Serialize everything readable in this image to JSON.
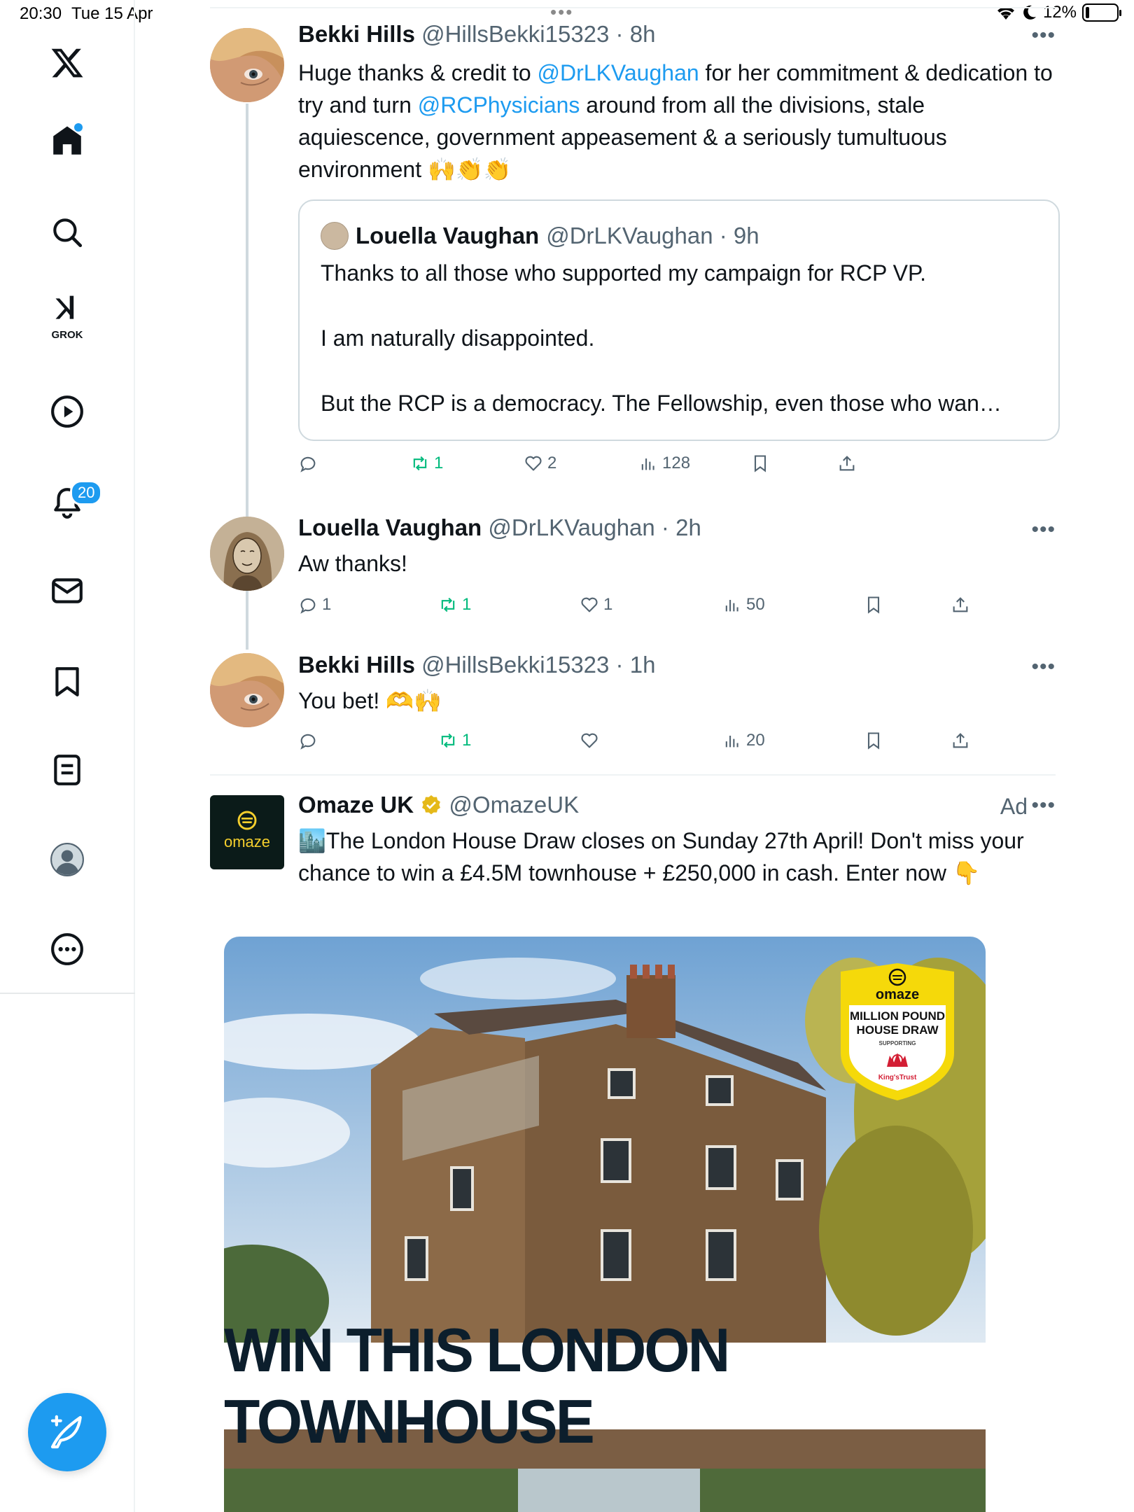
{
  "status_bar": {
    "time": "20:30",
    "date": "Tue 15 Apr",
    "battery": "12%"
  },
  "sidebar": {
    "grok_label": "GROK",
    "notification_count": "20"
  },
  "tweets": [
    {
      "name": "Bekki Hills",
      "handle": "@HillsBekki15323",
      "time": "8h",
      "text_parts": [
        "Huge thanks & credit to ",
        "@DrLKVaughan",
        " for her commitment & dedication to try and turn ",
        "@RCPhysicians",
        " around from all the divisions, stale aquiescence, government appeasement & a seriously tumultuous environment ",
        "🙌👏👏"
      ],
      "quote": {
        "name": "Louella Vaughan",
        "handle": "@DrLKVaughan",
        "time": "9h",
        "paragraphs": [
          "Thanks to all those who supported my campaign for RCP VP.",
          "I am naturally disappointed.",
          "But the RCP is a democracy. The Fellowship, even those who wan…"
        ]
      },
      "stats": {
        "replies": "",
        "reposts": "1",
        "likes": "2",
        "views": "128"
      }
    },
    {
      "name": "Louella Vaughan",
      "handle": "@DrLKVaughan",
      "time": "2h",
      "text": "Aw thanks!",
      "stats": {
        "replies": "1",
        "reposts": "1",
        "likes": "1",
        "views": "50"
      }
    },
    {
      "name": "Bekki Hills",
      "handle": "@HillsBekki15323",
      "time": "1h",
      "text": "You bet! 🫶🙌",
      "stats": {
        "replies": "",
        "reposts": "1",
        "likes": "",
        "views": "20"
      }
    }
  ],
  "ad": {
    "name": "Omaze UK",
    "handle": "@OmazeUK",
    "label": "Ad",
    "logo_text": "omaze",
    "text": "🏙️The London House Draw closes on Sunday 27th April! Don't miss your chance to win a £4.5M townhouse + £250,000 in cash. Enter now 👇",
    "image": {
      "banner": "WIN THIS LONDON TOWNHOUSE",
      "badge_brand": "omaze",
      "badge_title": "MILLION POUND HOUSE DRAW",
      "badge_supporting": "SUPPORTING",
      "badge_charity": "King'sTrust"
    }
  },
  "colors": {
    "accent": "#1d9bf0",
    "repost": "#00ba7c",
    "muted": "#536471",
    "omaze_yellow": "#f5cf2d"
  }
}
